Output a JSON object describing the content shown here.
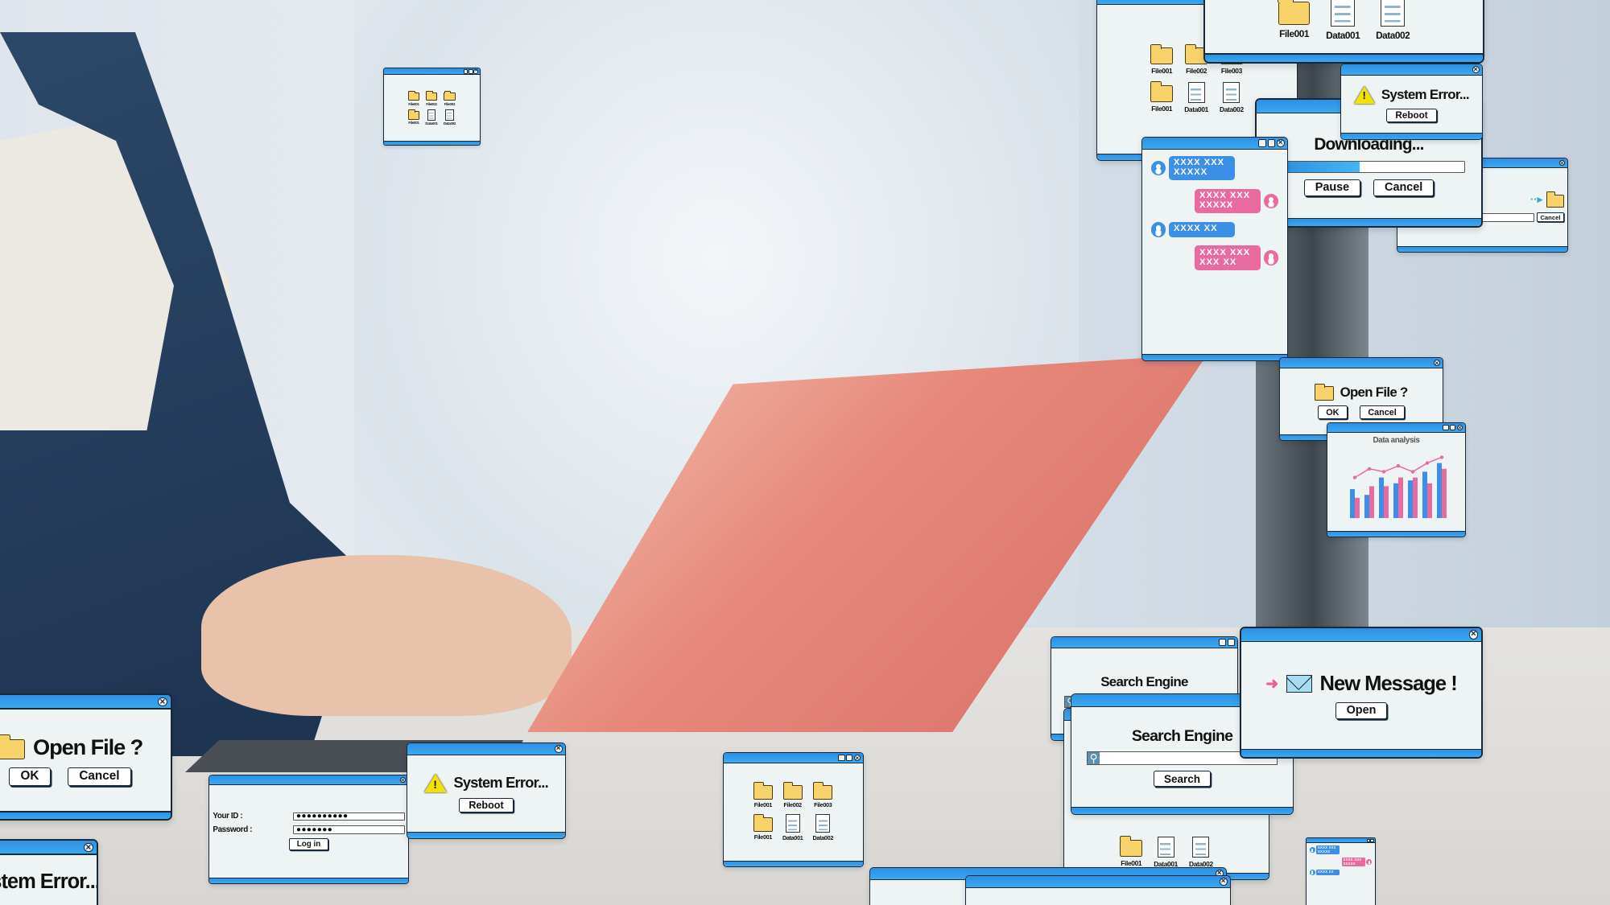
{
  "colors": {
    "window_bar": "#2f8fe3",
    "window_body": "#eef3f3",
    "chat_blue": "#3b8fe6",
    "chat_pink": "#e86a9e",
    "folder": "#f8d36a",
    "warning": "#f2e200"
  },
  "windows": {
    "file_small": {
      "files": [
        {
          "icon": "folder-icon",
          "label": "File001"
        },
        {
          "icon": "folder-icon",
          "label": "File002"
        },
        {
          "icon": "folder-icon",
          "label": "File003"
        },
        {
          "icon": "folder-icon",
          "label": "File001"
        },
        {
          "icon": "document-icon",
          "label": "Data001"
        },
        {
          "icon": "document-icon",
          "label": "Data002"
        }
      ]
    },
    "file_top_a": {
      "files": [
        {
          "icon": "folder-icon",
          "label": "File001"
        },
        {
          "icon": "folder-icon",
          "label": "File002"
        },
        {
          "icon": "folder-icon",
          "label": "File003"
        },
        {
          "icon": "folder-icon",
          "label": "File001"
        },
        {
          "icon": "document-icon",
          "label": "Data001"
        },
        {
          "icon": "document-icon",
          "label": "Data002"
        }
      ]
    },
    "file_top_b": {
      "files": [
        {
          "icon": "folder-icon",
          "label": "File001"
        },
        {
          "icon": "document-icon",
          "label": "Data001"
        },
        {
          "icon": "document-icon",
          "label": "Data002"
        }
      ]
    },
    "system_error_top": {
      "icon": "warning-icon",
      "message": "System Error...",
      "button": "Reboot"
    },
    "downloading": {
      "title": "Downloading...",
      "progress_percent": 45,
      "pause": "Pause",
      "cancel": "Cancel"
    },
    "transfer": {
      "cancel": "Cancel"
    },
    "chat": {
      "messages": [
        {
          "side": "left",
          "text": "XXXX XXX XXXXX"
        },
        {
          "side": "right",
          "text": "XXXX XXX XXXXX"
        },
        {
          "side": "left",
          "text": "XXXX XX"
        },
        {
          "side": "right",
          "text": "XXXX XXX XXX XX"
        }
      ]
    },
    "open_file_right": {
      "icon": "folder-icon",
      "message": "Open File ?",
      "ok": "OK",
      "cancel": "Cancel"
    },
    "data_analysis": {
      "title": "Data analysis",
      "chart_type": "bar-with-line",
      "bars_blue": [
        5,
        4,
        7,
        6,
        6.5,
        8,
        9.5
      ],
      "bars_pink": [
        3.5,
        5.5,
        5.5,
        7,
        7,
        6,
        8.5
      ],
      "line": [
        7,
        8.5,
        8,
        9,
        8,
        9.5,
        10.5
      ]
    },
    "search_back": {
      "title": "Search Engine"
    },
    "search_front": {
      "title": "Search Engine",
      "button": "Search"
    },
    "file_bottom": {
      "files": [
        {
          "icon": "folder-icon",
          "label": "File001"
        },
        {
          "icon": "document-icon",
          "label": "Data001"
        },
        {
          "icon": "document-icon",
          "label": "Data002"
        }
      ]
    },
    "new_message": {
      "icon": "envelope-icon",
      "message": "New Message !",
      "button": "Open"
    },
    "chat_small": {
      "messages": [
        {
          "side": "left",
          "text": "XXXX XXX XXXXX"
        },
        {
          "side": "right",
          "text": "XXXX XXX XXXXX"
        },
        {
          "side": "left",
          "text": "XXXX XX"
        }
      ]
    },
    "file_mid": {
      "files": [
        {
          "icon": "folder-icon",
          "label": "File001"
        },
        {
          "icon": "folder-icon",
          "label": "File002"
        },
        {
          "icon": "folder-icon",
          "label": "File003"
        },
        {
          "icon": "folder-icon",
          "label": "File001"
        },
        {
          "icon": "document-icon",
          "label": "Data001"
        },
        {
          "icon": "document-icon",
          "label": "Data002"
        }
      ]
    },
    "open_file_left": {
      "icon": "folder-icon",
      "message": "Open File ?",
      "ok": "OK",
      "cancel": "Cancel"
    },
    "system_error_left": {
      "message": "System Error..."
    },
    "login": {
      "id_label": "Your ID :",
      "password_label": "Password :",
      "id_value": "●●●●●●●●●●",
      "password_value": "●●●●●●●",
      "button": "Log in"
    },
    "system_error_mid": {
      "icon": "warning-icon",
      "message": "System Error...",
      "button": "Reboot"
    }
  }
}
